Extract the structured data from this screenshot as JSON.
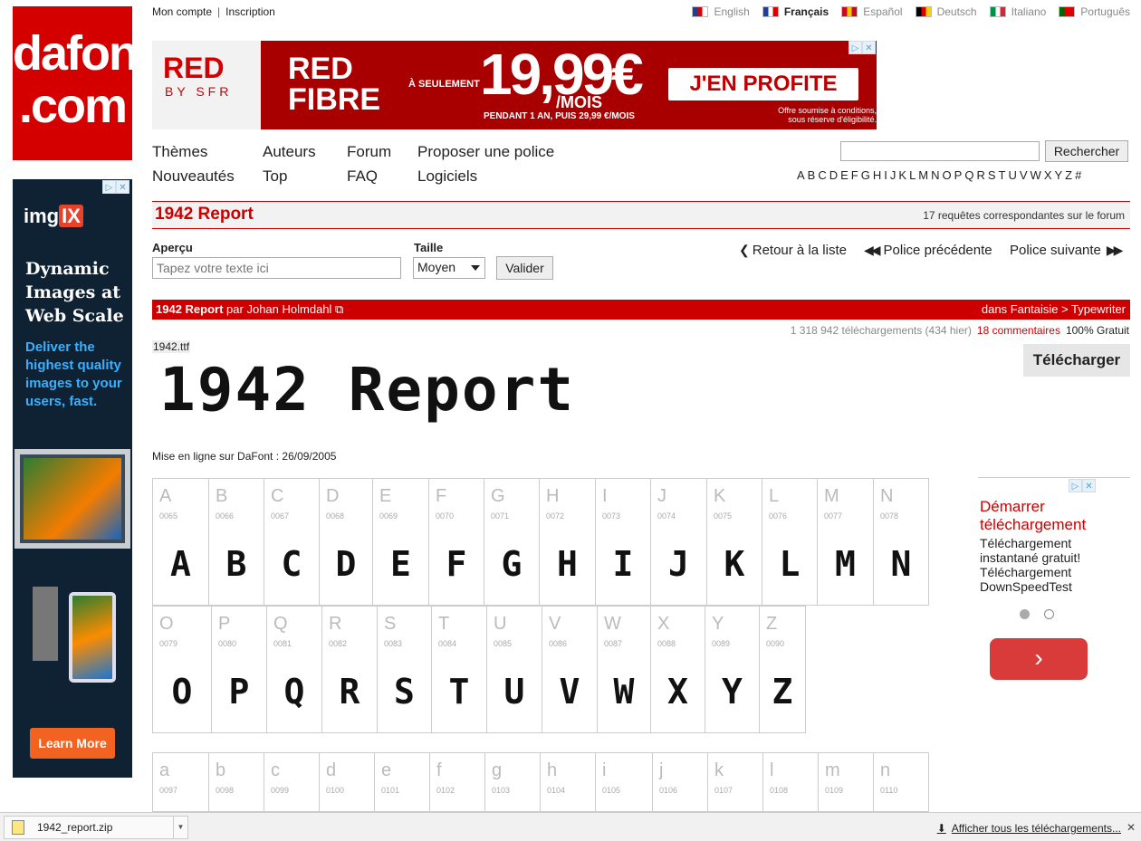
{
  "top_links": [
    "Mon compte",
    "Inscription"
  ],
  "languages": [
    {
      "label": "English",
      "colors": [
        "#1f3f8f",
        "#d00",
        "#fff"
      ]
    },
    {
      "label": "Français",
      "colors": [
        "#1f3fa0",
        "#fff",
        "#d00"
      ]
    },
    {
      "label": "Español",
      "colors": [
        "#c60b1e",
        "#ffc400",
        "#c60b1e"
      ]
    },
    {
      "label": "Deutsch",
      "colors": [
        "#000",
        "#d00",
        "#ffce00"
      ]
    },
    {
      "label": "Italiano",
      "colors": [
        "#009246",
        "#fff",
        "#ce2b37"
      ]
    },
    {
      "label": "Português",
      "colors": [
        "#006600",
        "#d00",
        "#d00"
      ]
    }
  ],
  "active_language": "Français",
  "banner": {
    "red": "RED",
    "by": "BY SFR",
    "fibre1": "RED",
    "fibre2": "FIBRE",
    "seul": "À SEULEMENT",
    "price": "19,99€",
    "mois": "/MOIS",
    "pend": "PENDANT 1 AN, PUIS 29,99 €/MOIS",
    "cta": "J'EN PROFITE",
    "cond1": "Offre soumise à conditions,",
    "cond2": "sous réserve d'éligibilité."
  },
  "sidead": {
    "brand": "img",
    "brand_ix": "IX",
    "head1": "Dynamic",
    "head2": "Images at",
    "head3": "Web Scale",
    "sub1": "Deliver the",
    "sub2": "highest quality",
    "sub3": "images to your",
    "sub4": "users, fast.",
    "learn": "Learn More"
  },
  "menu": {
    "themes": "Thèmes",
    "nouveautes": "Nouveautés",
    "auteurs": "Auteurs",
    "top": "Top",
    "forum": "Forum",
    "faq": "FAQ",
    "proposer": "Proposer une police",
    "logiciels": "Logiciels"
  },
  "search": {
    "button": "Rechercher",
    "value": ""
  },
  "alphabet": [
    "A",
    "B",
    "C",
    "D",
    "E",
    "F",
    "G",
    "H",
    "I",
    "J",
    "K",
    "L",
    "M",
    "N",
    "O",
    "P",
    "Q",
    "R",
    "S",
    "T",
    "U",
    "V",
    "W",
    "X",
    "Y",
    "Z",
    "#"
  ],
  "font": {
    "title": "1942 Report",
    "forum_count": "17 requêtes correspondantes sur le forum",
    "author_prefix": "par",
    "author": "Johan Holmdahl",
    "category": "dans Fantaisie > Typewriter",
    "downloads": "1 318 942 téléchargements (434 hier)",
    "comments": "18 commentaires",
    "license": "100% Gratuit",
    "file": "1942.ttf",
    "download_button": "Télécharger",
    "preview": "1942 Report",
    "online": "Mise en ligne sur DaFont : 26/09/2005"
  },
  "controls": {
    "apercu_label": "Aperçu",
    "apercu_placeholder": "Tapez votre texte ici",
    "taille_label": "Taille",
    "taille_value": "Moyen",
    "valider": "Valider",
    "retour": "Retour à la liste",
    "precedente": "Police précédente",
    "suivante": "Police suivante"
  },
  "charmap": {
    "upper1": [
      [
        "A",
        "0065"
      ],
      [
        "B",
        "0066"
      ],
      [
        "C",
        "0067"
      ],
      [
        "D",
        "0068"
      ],
      [
        "E",
        "0069"
      ],
      [
        "F",
        "0070"
      ],
      [
        "G",
        "0071"
      ],
      [
        "H",
        "0072"
      ],
      [
        "I",
        "0073"
      ],
      [
        "J",
        "0074"
      ],
      [
        "K",
        "0075"
      ],
      [
        "L",
        "0076"
      ],
      [
        "M",
        "0077"
      ],
      [
        "N",
        "0078"
      ]
    ],
    "upper2": [
      [
        "O",
        "0079"
      ],
      [
        "P",
        "0080"
      ],
      [
        "Q",
        "0081"
      ],
      [
        "R",
        "0082"
      ],
      [
        "S",
        "0083"
      ],
      [
        "T",
        "0084"
      ],
      [
        "U",
        "0085"
      ],
      [
        "V",
        "0086"
      ],
      [
        "W",
        "0087"
      ],
      [
        "X",
        "0088"
      ],
      [
        "Y",
        "0089"
      ],
      [
        "Z",
        "0090"
      ]
    ],
    "lower1": [
      [
        "a",
        "0097"
      ],
      [
        "b",
        "0098"
      ],
      [
        "c",
        "0099"
      ],
      [
        "d",
        "0100"
      ],
      [
        "e",
        "0101"
      ],
      [
        "f",
        "0102"
      ],
      [
        "g",
        "0103"
      ],
      [
        "h",
        "0104"
      ],
      [
        "i",
        "0105"
      ],
      [
        "j",
        "0106"
      ],
      [
        "k",
        "0107"
      ],
      [
        "l",
        "0108"
      ],
      [
        "m",
        "0109"
      ],
      [
        "n",
        "0110"
      ]
    ]
  },
  "right_ad": {
    "head1": "Démarrer",
    "head2": "téléchargement",
    "body1": "Téléchargement",
    "body2": "instantané gratuit!",
    "body3": "Téléchargement",
    "body4": "DownSpeedTest",
    "arrow": "›"
  },
  "download_bar": {
    "file": "1942_report.zip",
    "show_all": "Afficher tous les téléchargements...",
    "close": "✕"
  }
}
